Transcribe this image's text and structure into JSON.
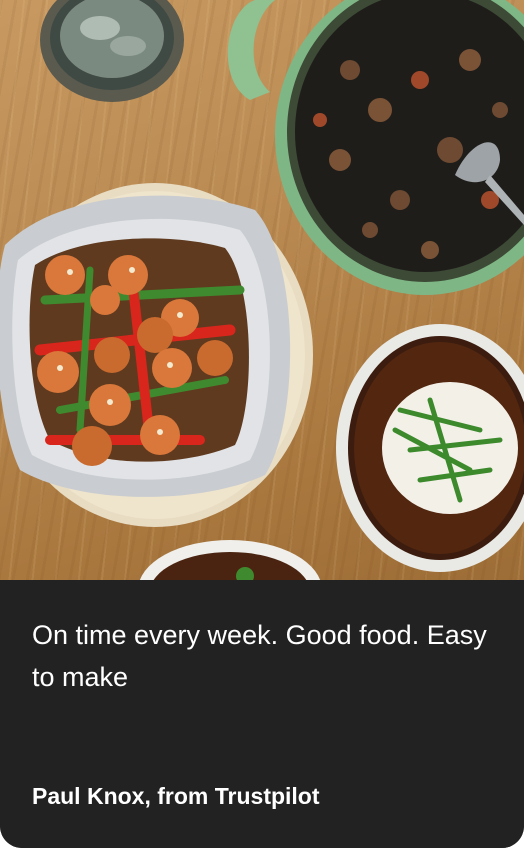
{
  "photo": {
    "icon": "food-photo-icon"
  },
  "testimonial": {
    "quote": "On time every week. Good food. Easy to make",
    "author": "Paul Knox,",
    "source": " from Trustpilot"
  },
  "colors": {
    "panel_background": "#222222",
    "text": "#ffffff"
  }
}
